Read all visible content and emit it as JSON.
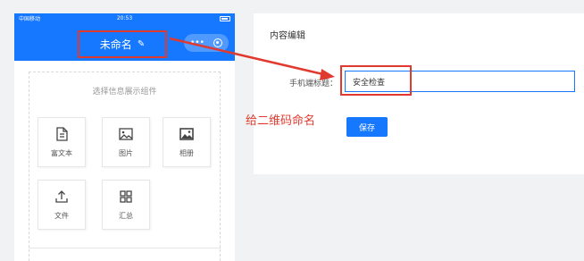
{
  "statusbar": {
    "carrier": "中国移动",
    "time": "20:53"
  },
  "header": {
    "title": "未命名",
    "edit_icon": "pencil-icon",
    "more_icon": "ellipsis-icon",
    "close_icon": "target-icon"
  },
  "picker": {
    "title": "选择信息展示组件",
    "items": [
      {
        "label": "富文本",
        "icon": "document-icon"
      },
      {
        "label": "图片",
        "icon": "image-icon"
      },
      {
        "label": "相册",
        "icon": "album-icon"
      },
      {
        "label": "文件",
        "icon": "upload-icon"
      },
      {
        "label": "汇总",
        "icon": "grid-icon"
      }
    ]
  },
  "editor": {
    "title": "内容编辑",
    "field_label": "手机端标题：",
    "field_value": "安全检查",
    "save_label": "保存"
  },
  "annotation": {
    "text": "给二维码命名",
    "color": "#e03a2f"
  },
  "colors": {
    "accent": "#1677ff",
    "highlight": "#e03a2f"
  }
}
